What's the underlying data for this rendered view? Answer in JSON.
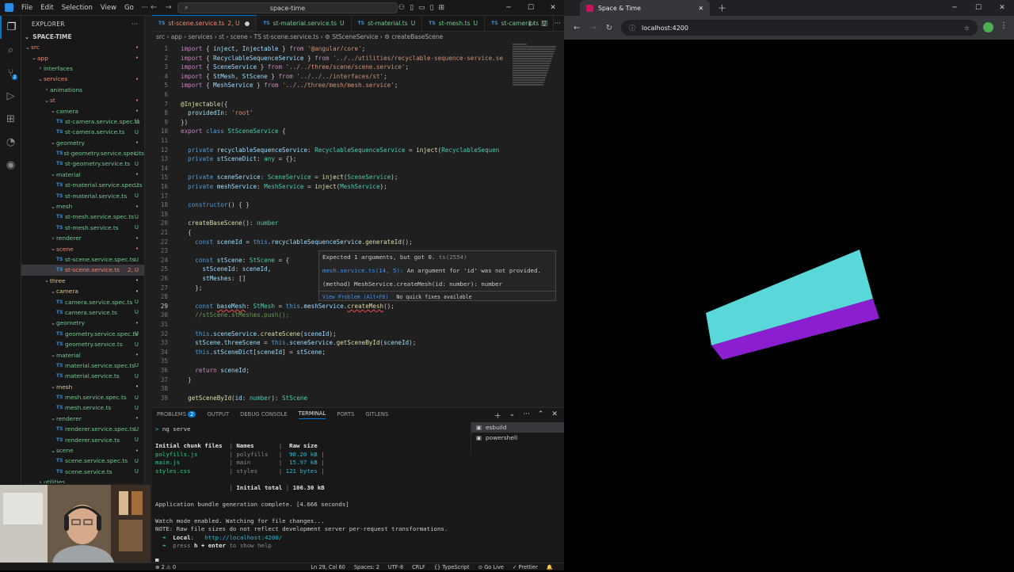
{
  "titlebar": {
    "menu": [
      "File",
      "Edit",
      "Selection",
      "View",
      "Go",
      "···"
    ],
    "search": "space-time",
    "back": "←",
    "fwd": "→"
  },
  "activity": {
    "scm_badge": "2"
  },
  "explorer": {
    "title": "EXPLORER",
    "project": "SPACE-TIME",
    "rows": [
      {
        "label": "src",
        "indent": 0,
        "type": "folder",
        "open": true,
        "status": "•",
        "cls": "gerr"
      },
      {
        "label": "app",
        "indent": 1,
        "type": "folder",
        "open": true,
        "status": "•",
        "cls": "gerr"
      },
      {
        "label": "interfaces",
        "indent": 2,
        "type": "folder",
        "open": false,
        "status": "",
        "cls": "gfold"
      },
      {
        "label": "services",
        "indent": 2,
        "type": "folder",
        "open": true,
        "status": "•",
        "cls": "gerr"
      },
      {
        "label": "animations",
        "indent": 3,
        "type": "folder",
        "open": false,
        "status": "",
        "cls": "gfold"
      },
      {
        "label": "st",
        "indent": 3,
        "type": "folder",
        "open": true,
        "status": "•",
        "cls": "gerr"
      },
      {
        "label": "camera",
        "indent": 4,
        "type": "folder",
        "open": true,
        "status": "•",
        "cls": "gfold"
      },
      {
        "label": "st-camera.service.spec.ts",
        "indent": 5,
        "type": "ts",
        "status": "U",
        "cls": "gfold"
      },
      {
        "label": "st-camera.service.ts",
        "indent": 5,
        "type": "ts",
        "status": "U",
        "cls": "gfold"
      },
      {
        "label": "geometry",
        "indent": 4,
        "type": "folder",
        "open": true,
        "status": "•",
        "cls": "gfold"
      },
      {
        "label": "st-geometry.service.spec.ts",
        "indent": 5,
        "type": "ts",
        "status": "U",
        "cls": "gfold"
      },
      {
        "label": "st-geometry.service.ts",
        "indent": 5,
        "type": "ts",
        "status": "U",
        "cls": "gfold"
      },
      {
        "label": "material",
        "indent": 4,
        "type": "folder",
        "open": true,
        "status": "•",
        "cls": "gfold"
      },
      {
        "label": "st-material.service.spec.ts",
        "indent": 5,
        "type": "ts",
        "status": "U",
        "cls": "gfold"
      },
      {
        "label": "st-material.service.ts",
        "indent": 5,
        "type": "ts",
        "status": "U",
        "cls": "gfold"
      },
      {
        "label": "mesh",
        "indent": 4,
        "type": "folder",
        "open": true,
        "status": "•",
        "cls": "gfold"
      },
      {
        "label": "st-mesh.service.spec.ts",
        "indent": 5,
        "type": "ts",
        "status": "U",
        "cls": "gfold"
      },
      {
        "label": "st-mesh.service.ts",
        "indent": 5,
        "type": "ts",
        "status": "U",
        "cls": "gfold"
      },
      {
        "label": "renderer",
        "indent": 4,
        "type": "folder",
        "open": false,
        "status": "•",
        "cls": "gfold"
      },
      {
        "label": "scene",
        "indent": 4,
        "type": "folder",
        "open": true,
        "status": "•",
        "cls": "gerr"
      },
      {
        "label": "st-scene.service.spec.ts",
        "indent": 5,
        "type": "ts",
        "status": "U",
        "cls": "gfold"
      },
      {
        "label": "st-scene.service.ts",
        "indent": 5,
        "type": "ts",
        "status": "2, U",
        "cls": "gerr",
        "sel": true
      },
      {
        "label": "three",
        "indent": 3,
        "type": "folder",
        "open": true,
        "status": "•",
        "cls": "gmod"
      },
      {
        "label": "camera",
        "indent": 4,
        "type": "folder",
        "open": true,
        "status": "•",
        "cls": "gmod"
      },
      {
        "label": "camera.service.spec.ts",
        "indent": 5,
        "type": "ts",
        "status": "U",
        "cls": "gfold"
      },
      {
        "label": "camera.service.ts",
        "indent": 5,
        "type": "ts",
        "status": "U",
        "cls": "gfold"
      },
      {
        "label": "geometry",
        "indent": 4,
        "type": "folder",
        "open": true,
        "status": "•",
        "cls": "gfold"
      },
      {
        "label": "geometry.service.spec.ts",
        "indent": 5,
        "type": "ts",
        "status": "U",
        "cls": "gfold"
      },
      {
        "label": "geometry.service.ts",
        "indent": 5,
        "type": "ts",
        "status": "U",
        "cls": "gfold"
      },
      {
        "label": "material",
        "indent": 4,
        "type": "folder",
        "open": true,
        "status": "•",
        "cls": "gfold"
      },
      {
        "label": "material.service.spec.ts",
        "indent": 5,
        "type": "ts",
        "status": "U",
        "cls": "gfold"
      },
      {
        "label": "material.service.ts",
        "indent": 5,
        "type": "ts",
        "status": "U",
        "cls": "gfold"
      },
      {
        "label": "mesh",
        "indent": 4,
        "type": "folder",
        "open": true,
        "status": "•",
        "cls": "gmod"
      },
      {
        "label": "mesh.service.spec.ts",
        "indent": 5,
        "type": "ts",
        "status": "U",
        "cls": "gfold"
      },
      {
        "label": "mesh.service.ts",
        "indent": 5,
        "type": "ts",
        "status": "U",
        "cls": "gfold"
      },
      {
        "label": "renderer",
        "indent": 4,
        "type": "folder",
        "open": true,
        "status": "•",
        "cls": "gfold"
      },
      {
        "label": "renderer.service.spec.ts",
        "indent": 5,
        "type": "ts",
        "status": "U",
        "cls": "gfold"
      },
      {
        "label": "renderer.service.ts",
        "indent": 5,
        "type": "ts",
        "status": "U",
        "cls": "gfold"
      },
      {
        "label": "scene",
        "indent": 4,
        "type": "folder",
        "open": true,
        "status": "•",
        "cls": "gfold"
      },
      {
        "label": "scene.service.spec.ts",
        "indent": 5,
        "type": "ts",
        "status": "U",
        "cls": "gfold"
      },
      {
        "label": "scene.service.ts",
        "indent": 5,
        "type": "ts",
        "status": "U",
        "cls": "gfold"
      },
      {
        "label": "utilities",
        "indent": 2,
        "type": "folder",
        "open": false,
        "status": "",
        "cls": "gfold"
      }
    ]
  },
  "tabs": [
    {
      "label": "st-scene.service.ts",
      "suffix": "2, U",
      "active": true
    },
    {
      "label": "st-material.service.ts",
      "suffix": "U"
    },
    {
      "label": "st-material.ts",
      "suffix": "U"
    },
    {
      "label": "st-mesh.ts",
      "suffix": "U"
    },
    {
      "label": "st-camera.ts",
      "suffix": "U"
    }
  ],
  "breadcrumbs": "src › app › services › st › scene › TS st-scene.service.ts › ⚙ StSceneService › ⚙ createBaseScene",
  "code": [
    {
      "n": "1",
      "h": "<span class='k'>import</span> { <span class='v'>inject</span>, <span class='v'>Injectable</span> } <span class='k'>from</span> <span class='s'>'@angular/core'</span>;"
    },
    {
      "n": "2",
      "h": "<span class='k'>import</span> { <span class='v'>RecyclableSequenceService</span> } <span class='k'>from</span> <span class='s'>'../../utilities/recyclable-sequence-service.se</span>"
    },
    {
      "n": "3",
      "h": "<span class='k'>import</span> { <span class='v'>SceneService</span> } <span class='k'>from</span> <span class='s'>'../../three/scene/scene.service'</span>;"
    },
    {
      "n": "4",
      "h": "<span class='k'>import</span> { <span class='v'>StMesh</span>, <span class='v'>StScene</span> } <span class='k'>from</span> <span class='s'>'../../../interfaces/st'</span>;"
    },
    {
      "n": "5",
      "h": "<span class='k'>import</span> { <span class='v'>MeshService</span> } <span class='k'>from</span> <span class='s'>'../../three/mesh/mesh.service'</span>;"
    },
    {
      "n": "6",
      "h": ""
    },
    {
      "n": "7",
      "h": "<span class='d'>@Injectable</span>({"
    },
    {
      "n": "8",
      "h": "  <span class='v'>providedIn</span>: <span class='s'>'root'</span>"
    },
    {
      "n": "9",
      "h": "})"
    },
    {
      "n": "10",
      "h": "<span class='k'>export</span> <span class='b'>class</span> <span class='t'>StSceneService</span> {"
    },
    {
      "n": "11",
      "h": ""
    },
    {
      "n": "12",
      "h": "  <span class='b'>private</span> <span class='v'>recyclableSequenceService</span>: <span class='t'>RecyclableSequenceService</span> = <span class='f'>inject</span>(<span class='t'>RecyclableSequen</span>"
    },
    {
      "n": "13",
      "h": "  <span class='b'>private</span> <span class='v'>stSceneDict</span>: <span class='t'>any</span> = {};"
    },
    {
      "n": "14",
      "h": ""
    },
    {
      "n": "15",
      "h": "  <span class='b'>private</span> <span class='v'>sceneService</span>: <span class='t'>SceneService</span> = <span class='f'>inject</span>(<span class='t'>SceneService</span>);"
    },
    {
      "n": "16",
      "h": "  <span class='b'>private</span> <span class='v'>meshService</span>: <span class='t'>MeshService</span> = <span class='f'>inject</span>(<span class='t'>MeshService</span>);"
    },
    {
      "n": "17",
      "h": ""
    },
    {
      "n": "18",
      "h": "  <span class='b'>constructor</span>() { }"
    },
    {
      "n": "19",
      "h": ""
    },
    {
      "n": "20",
      "h": "  <span class='f'>createBaseScene</span>(): <span class='t'>number</span>"
    },
    {
      "n": "21",
      "h": "  {"
    },
    {
      "n": "22",
      "h": "    <span class='b'>const</span> <span class='v'>sceneId</span> = <span class='b'>this</span>.<span class='v'>recyclableSequenceService</span>.<span class='f'>generateId</span>();"
    },
    {
      "n": "23",
      "h": ""
    },
    {
      "n": "24",
      "h": "    <span class='b'>const</span> <span class='v'>stScene</span>: <span class='t'>StScene</span> = {"
    },
    {
      "n": "25",
      "h": "      <span class='v'>stSceneId</span>: <span class='v'>sceneId</span>,"
    },
    {
      "n": "26",
      "h": "      <span class='v'>stMeshes</span>: []"
    },
    {
      "n": "27",
      "h": "    };"
    },
    {
      "n": "28",
      "h": ""
    },
    {
      "n": "29",
      "h": "    <span class='b'>const</span> <span class='v squig'>baseMesh</span>: <span class='t'>StMesh</span> = <span class='b'>this</span>.<span class='v'>meshService</span>.<span class='f squig'>createMesh</span>();",
      "cur": true
    },
    {
      "n": "30",
      "h": "    <span class='c'>//stScene.stMeshes.push();</span>"
    },
    {
      "n": "31",
      "h": ""
    },
    {
      "n": "32",
      "h": "    <span class='b'>this</span>.<span class='v'>sceneService</span>.<span class='f'>createScene</span>(<span class='v'>sceneId</span>);"
    },
    {
      "n": "33",
      "h": "    <span class='v'>stScene</span>.<span class='v'>threeScene</span> = <span class='b'>this</span>.<span class='v'>sceneService</span>.<span class='f'>getSceneById</span>(<span class='v'>sceneId</span>);"
    },
    {
      "n": "34",
      "h": "    <span class='b'>this</span>.<span class='v'>stSceneDict</span>[<span class='v'>sceneId</span>] = <span class='v'>stScene</span>;"
    },
    {
      "n": "35",
      "h": ""
    },
    {
      "n": "36",
      "h": "    <span class='k'>return</span> <span class='v'>sceneId</span>;"
    },
    {
      "n": "37",
      "h": "  }"
    },
    {
      "n": "38",
      "h": ""
    },
    {
      "n": "39",
      "h": "  <span class='f'>getSceneById</span>(<span class='v'>id</span>: <span class='t'>number</span>): <span class='t'>StScene</span>"
    }
  ],
  "hover": {
    "l1": "Expected 1 arguments, but got 0.",
    "l1b": "ts(2554)",
    "l2a": "mesh.service.ts(14, 5):",
    "l2b": "An argument for 'id' was not provided.",
    "l3": "(method) MeshService.createMesh(id: number): number",
    "view": "View Problem (Alt+F8)",
    "nofix": "No quick fixes available"
  },
  "panel": {
    "tabs": [
      "PROBLEMS",
      "OUTPUT",
      "DEBUG CONSOLE",
      "TERMINAL",
      "PORTS",
      "GITLENS"
    ],
    "problems_count": "2",
    "active": "TERMINAL"
  },
  "terminal": [
    {
      "h": "<span class='tc'>&gt;</span> ng serve"
    },
    {
      "h": ""
    },
    {
      "h": "<span class='tb'>Initial chunk files</span>  <span class='tdim'>|</span> <span class='tb'>Names</span>       <span class='tdim'>|</span>  <span class='tb'>Raw size</span>"
    },
    {
      "h": "<span class='tg'>polyfills.js</span>         <span class='tdim'>| polyfills   |</span>  <span class='tc'>90.20 kB</span> <span class='tdim'>|</span>"
    },
    {
      "h": "<span class='tg'>main.js</span>              <span class='tdim'>| main        |</span>  <span class='tc'>15.97 kB</span> <span class='tdim'>|</span>"
    },
    {
      "h": "<span class='tg'>styles.css</span>           <span class='tdim'>| styles      |</span> <span class='tc'>121 bytes</span> <span class='tdim'>|</span>"
    },
    {
      "h": ""
    },
    {
      "h": "                     <span class='tdim'>|</span> <span class='tb'>Initial total</span> <span class='tdim'>|</span> <span class='tb'>106.30 kB</span>"
    },
    {
      "h": ""
    },
    {
      "h": "Application bundle generation complete. [4.666 seconds]"
    },
    {
      "h": ""
    },
    {
      "h": "Watch mode enabled. Watching for file changes..."
    },
    {
      "h": "NOTE: Raw file sizes do not reflect development server per-request transformations."
    },
    {
      "h": "  <span class='tg'>➜</span>  <span class='tb'>Local</span>:   <span class='tc'>http://localhost:4200/</span>"
    },
    {
      "h": "  <span class='tg'>➜</span>  <span class='tdim'>press</span> <span class='tb'>h + enter</span> <span class='tdim'>to show help</span>"
    },
    {
      "h": ""
    },
    {
      "h": "█"
    }
  ],
  "terminal_list": [
    "esbuild",
    "powershell"
  ],
  "status": {
    "left": "⊗ 2 ⚠ 0",
    "ln": "Ln 29, Col 60",
    "spaces": "Spaces: 2",
    "enc": "UTF-8",
    "eol": "CRLF",
    "lang": "{} TypeScript",
    "live": "⊙ Go Live",
    "prettier": "✓ Prettier"
  },
  "browser": {
    "tab_title": "Space & Time",
    "url": "localhost:4200"
  },
  "scene": {
    "top_color": "#5ad8d9",
    "side_color": "#8b1fd0"
  }
}
